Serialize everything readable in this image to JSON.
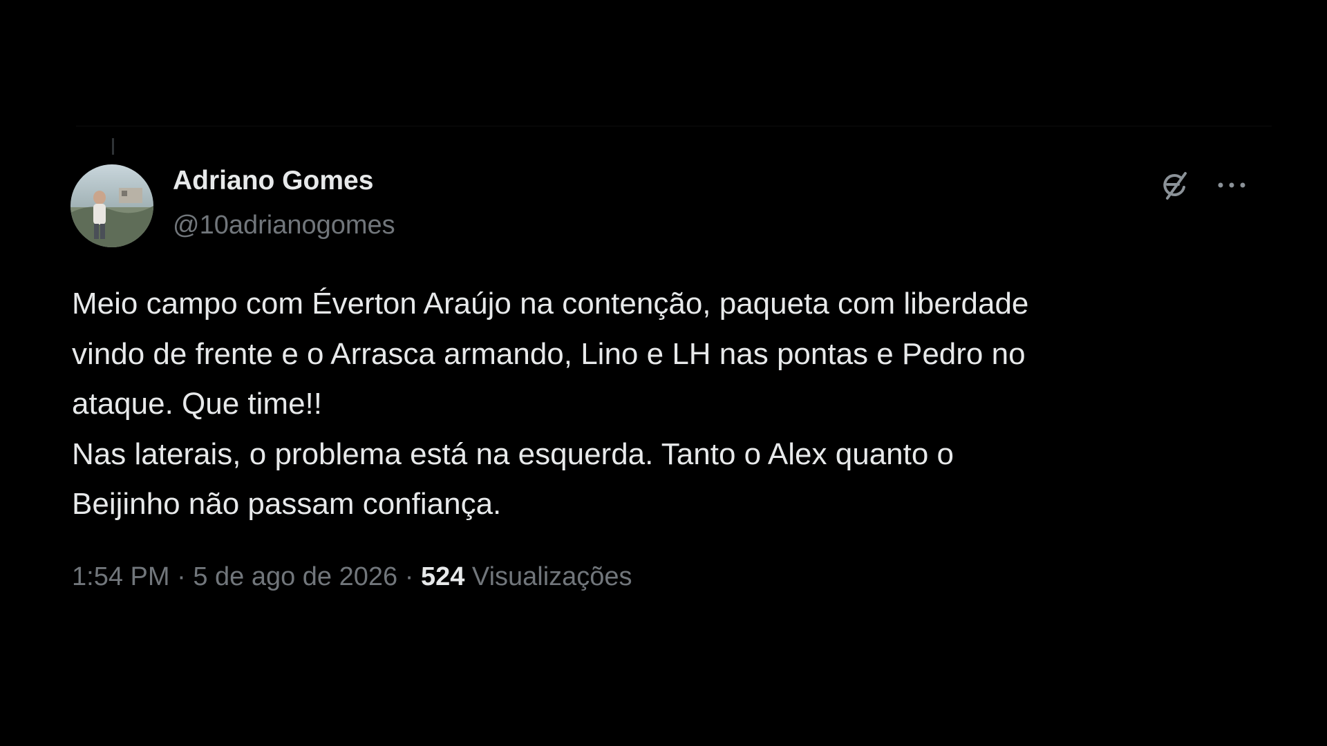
{
  "author": {
    "display_name": "Adriano Gomes",
    "handle": "@10adrianogomes"
  },
  "tweet": {
    "lines": [
      "Meio campo com Éverton Araújo na contenção, paqueta com liberdade",
      "vindo de frente e o Arrasca armando, Lino e LH nas pontas e Pedro no",
      "ataque. Que time!!",
      "Nas laterais, o problema está na esquerda. Tanto o Alex quanto o",
      "Beijinho não passam confiança."
    ]
  },
  "meta": {
    "time": "1:54 PM",
    "separator": "·",
    "date": "5 de ago de 2026",
    "views_count": "524",
    "views_label": "Visualizações"
  },
  "icons": {
    "grok": "grok-icon",
    "more": "more-icon"
  },
  "colors": {
    "background": "#000000",
    "primary_text": "#e7e9ea",
    "secondary_text": "#71767b"
  }
}
